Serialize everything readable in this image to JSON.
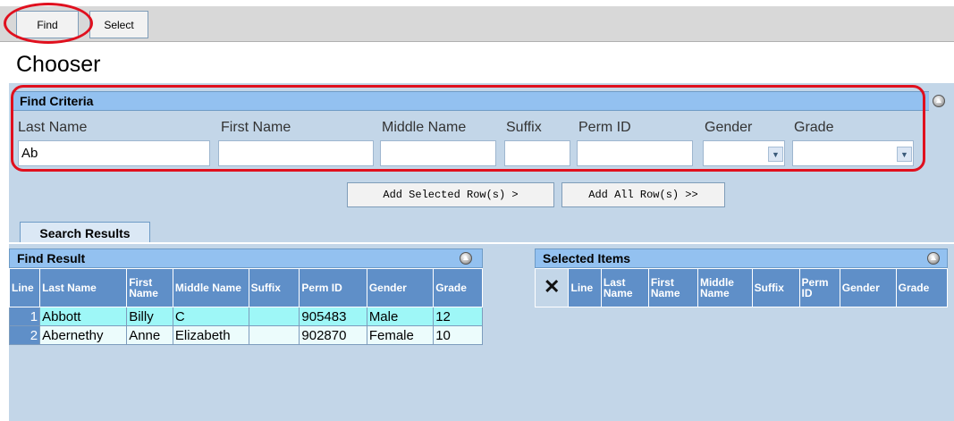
{
  "tabs": {
    "find": "Find",
    "select": "Select"
  },
  "page_title": "Chooser",
  "criteria": {
    "header": "Find Criteria",
    "labels": {
      "last_name": "Last Name",
      "first_name": "First Name",
      "middle_name": "Middle Name",
      "suffix": "Suffix",
      "perm_id": "Perm ID",
      "gender": "Gender",
      "grade": "Grade"
    },
    "values": {
      "last_name": "Ab",
      "first_name": "",
      "middle_name": "",
      "suffix": "",
      "perm_id": ""
    }
  },
  "buttons": {
    "add_selected": "Add Selected Row(s) >",
    "add_all": "Add All Row(s) >>"
  },
  "search_results_tab": "Search Results",
  "find_result": {
    "header": "Find Result",
    "columns": [
      "Line",
      "Last Name",
      "First Name",
      "Middle Name",
      "Suffix",
      "Perm ID",
      "Gender",
      "Grade"
    ],
    "rows": [
      {
        "line": "1",
        "last": "Abbott",
        "first": "Billy",
        "middle": "C",
        "suffix": "",
        "perm": "905483",
        "gender": "Male",
        "grade": "12"
      },
      {
        "line": "2",
        "last": "Abernethy",
        "first": "Anne",
        "middle": "Elizabeth",
        "suffix": "",
        "perm": "902870",
        "gender": "Female",
        "grade": "10"
      }
    ]
  },
  "selected_items": {
    "header": "Selected Items",
    "columns": [
      "Line",
      "Last Name",
      "First Name",
      "Middle Name",
      "Suffix",
      "Perm ID",
      "Gender",
      "Grade"
    ]
  },
  "icons": {
    "collapse": "collapse-icon",
    "remove": "x-icon",
    "dropdown": "chevron-down-icon"
  },
  "colors": {
    "highlight_ring": "#e0101e",
    "panel_header": "#93c1f0",
    "grid_header": "#5f8fc8",
    "row_selected": "#9ef7f7"
  }
}
